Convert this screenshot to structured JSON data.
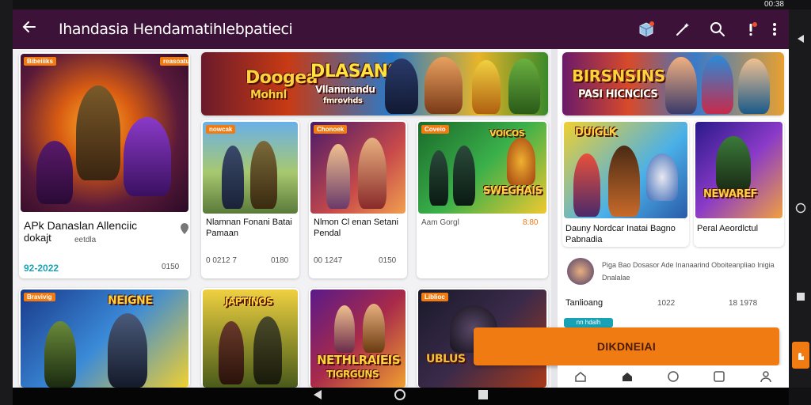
{
  "status": {
    "clock": "00:38"
  },
  "topbar": {
    "title": "Ihandasia Hendamatihlebpatieci"
  },
  "banners": [
    {
      "line1": "Doogea",
      "line2": "DLASANS",
      "line3": "Mohnl",
      "line4": "Vllanmandu",
      "subtitle": "fmrovhds"
    },
    {
      "line1": "BIRSNSINS",
      "line2": "PASI HICNCICS"
    }
  ],
  "featured": {
    "tag": "Bibeiiiks",
    "corner_tag": "reasoatu",
    "title": "APk Danaslan Allenciic",
    "subtitle": "dokajt",
    "meta": "eetdla",
    "price": "92-2022",
    "rating": "0150"
  },
  "cards": [
    {
      "tag": "nowcak",
      "title": "Nlamnan Fonani Batai",
      "subtitle": "Pamaan",
      "price": "0 0212 7",
      "rating": "0180"
    },
    {
      "tag": "Chonoek",
      "title": "Nlmon Cl enan Setani",
      "subtitle": "Pendal",
      "price": "00 1247",
      "rating": "0150"
    },
    {
      "tag": "Coveio",
      "title": "",
      "subtitle": "",
      "art_label": "SWEGHAIS",
      "art_top": "VOICOS",
      "price": "Aam Gorgl",
      "rating": "8:80"
    }
  ],
  "right_cards": [
    {
      "art_label": "DUIGLK",
      "title": "Dauny Nordcar Inatai Bagno",
      "subtitle": "Pabnadia"
    },
    {
      "art_label": "NEWAREF",
      "title": "Peral Aeordlctul",
      "subtitle": ""
    }
  ],
  "right_info": {
    "avatar_text": "Piga Bao Dosasor Ade Inanaarind Oboiteanpliao Inigia",
    "sub": "Dnalalae",
    "row_label": "Tanlioang",
    "row_a": "1022",
    "row_b": "18 1978",
    "chip": "nn  hdalh"
  },
  "bottom_cards": [
    {
      "tag": "Bravivig",
      "art_label": "NEIGNE"
    },
    {
      "tag": "",
      "art_label": "JAPTINOS"
    },
    {
      "tag": "",
      "art_label": "NETHLRAIEIS",
      "art_sub": "TIGRGUNS"
    },
    {
      "tag": "Liblioc",
      "art_label": "UBLUS"
    }
  ],
  "cta": {
    "label": "DIKDNEIAI"
  },
  "colors": {
    "topbar": "#3c1238",
    "accent": "#f07b12",
    "price": "#19a1b5"
  }
}
